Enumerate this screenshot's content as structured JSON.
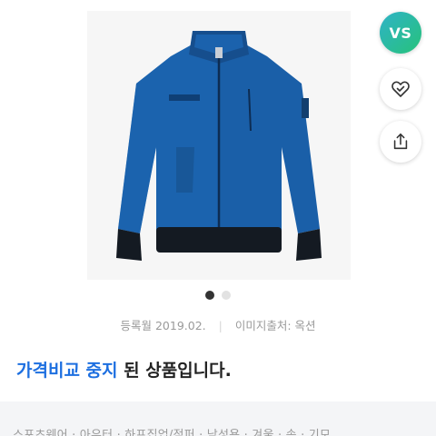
{
  "side_actions": {
    "vs_label": "VS"
  },
  "gallery": {
    "total_images": 2,
    "current_index": 1
  },
  "meta": {
    "registered": "등록월 2019.02.",
    "image_source": "이미지출처: 옥션"
  },
  "status": {
    "highlight": "가격비교 중지",
    "rest": " 된 상품입니다."
  },
  "bottom": {
    "partial_text": "스포츠웨어 · 아우터 · 하프집업/점퍼 · 남성용 · 겨울 · 솜 · 기모"
  },
  "colors": {
    "accent_blue": "#1d6fe0",
    "vs_gradient_start": "#2fb3c7",
    "vs_gradient_end": "#27c27a",
    "jacket_blue": "#1a5fa8"
  }
}
